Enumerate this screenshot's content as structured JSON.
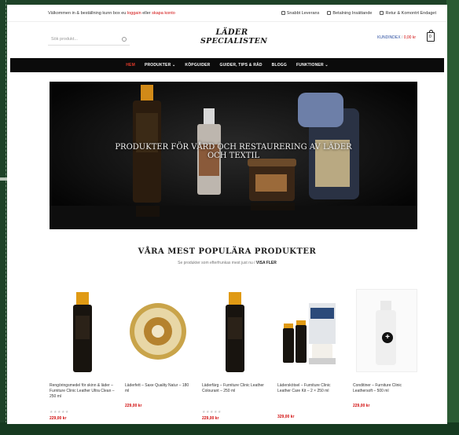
{
  "topbar": {
    "welcome_prefix": "Välkommen in & beställning kunn box eu",
    "login_link": "loggain",
    "welcome_mid": "eller",
    "register_link": "skapa konto",
    "usps": [
      "Snabbt Leverans",
      "Betalning Insättande",
      "Retur & Komontrt Endaget"
    ]
  },
  "header": {
    "search_placeholder": "Sök produkt...",
    "logo_line1": "LÄDER",
    "logo_line2": "SPECIALISTEN",
    "account_label": "KUNDINDEX",
    "account_sep": "/",
    "account_total": "0,00 kr",
    "cart_count": "0"
  },
  "nav": {
    "items": [
      {
        "label": "HEM",
        "active": true
      },
      {
        "label": "PRODUKTER ⌄",
        "active": false
      },
      {
        "label": "KÖPGUIDER",
        "active": false
      },
      {
        "label": "GUIDER, TIPS & RÅD",
        "active": false
      },
      {
        "label": "BLOGG",
        "active": false
      },
      {
        "label": "FUNKTIONER ⌄",
        "active": false
      }
    ]
  },
  "hero": {
    "title_line1": "PRODUKTER FÖR VÅRD OCH RESTAURERING AV LÄDER",
    "title_line2": "OCH TEXTIL"
  },
  "popular": {
    "title": "VÅRA MEST POPULÄRA PRODUKTER",
    "subtitle_prefix": "Se produkter som efterfrunkas mest just nu /",
    "subtitle_link": "VISA FLER"
  },
  "products": [
    {
      "name": "Rengöringsmedel för skinn & läder – Furniture Clinic Leather Ultra Clean – 250 ml",
      "stars": "★★★★★",
      "price": "229,00 kr",
      "image": "dark-bottle-orange-cap"
    },
    {
      "name": "Läderfett – Saxe Quality Natur – 180 ml",
      "stars": "",
      "price": "229,00 kr",
      "image": "round-tin"
    },
    {
      "name": "Läderfärg – Furniture Clinic Leather Colourant – 250 ml",
      "stars": "★★★★★",
      "price": "229,00 kr",
      "image": "dark-bottle-orange-cap"
    },
    {
      "name": "Läderskötsel – Furniture Clinic Leather Care Kit – 2 × 250 ml",
      "stars": "",
      "price": "329,00 kr",
      "image": "care-kit"
    },
    {
      "name": "Conditiner – Furniture Clinic Leathersoft – 500 ml",
      "stars": "",
      "price": "229,00 kr",
      "image": "placeholder"
    }
  ],
  "colors": {
    "accent_red": "#d10c0c",
    "nav_bg": "#0b0b0b",
    "frame_green": "#1e4228"
  }
}
